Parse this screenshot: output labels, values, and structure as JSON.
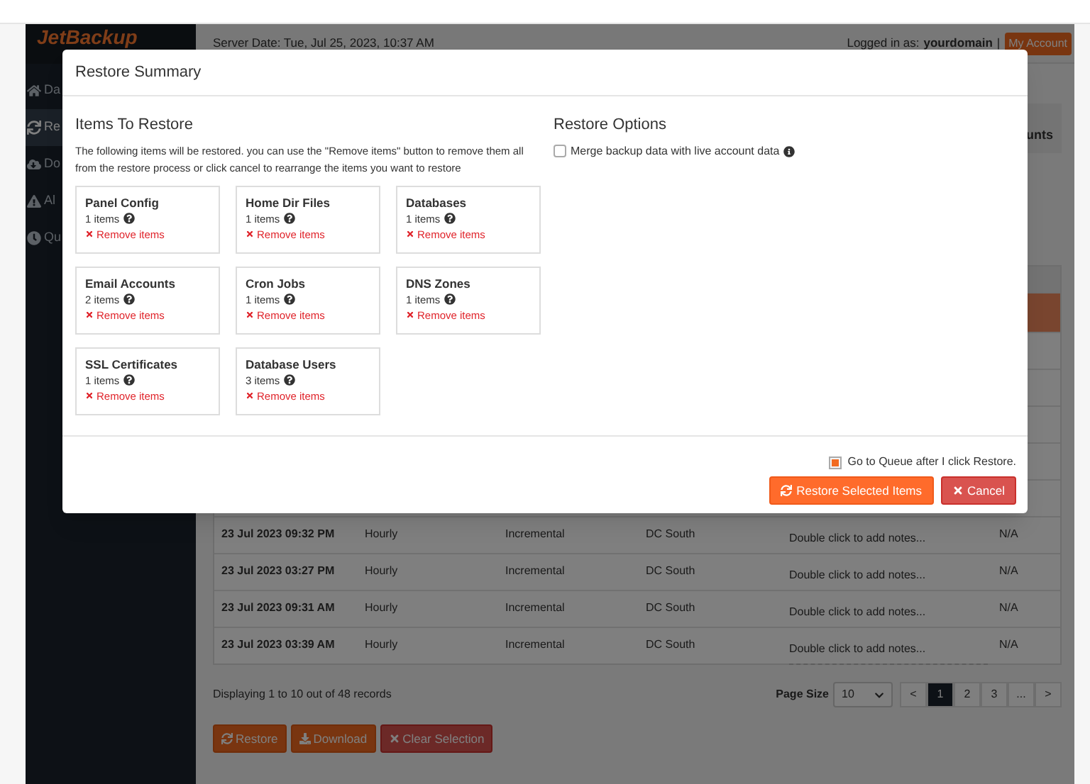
{
  "app": {
    "logo": "JetBackup",
    "server_date": "Server Date: Tue, Jul 25, 2023, 10:37 AM",
    "logged_in_label": "Logged in as:",
    "username": "yourdomain",
    "separator": "|",
    "account_button": "My Account"
  },
  "sidebar": {
    "items": [
      {
        "label": "Da",
        "selected": false
      },
      {
        "label": "Re",
        "selected": true
      },
      {
        "label": "Do",
        "selected": false
      },
      {
        "label": "Al",
        "selected": false
      },
      {
        "label": "Qu",
        "selected": false
      }
    ]
  },
  "background_tab": {
    "label": "unts"
  },
  "table": {
    "rows": [
      {
        "selected": true
      },
      {
        "selected": false
      },
      {
        "selected": false
      },
      {
        "selected": false
      },
      {
        "selected": false
      },
      {
        "selected": false
      },
      {
        "selected": false,
        "cells": [
          "23 Jul 2023 09:32 PM",
          "Hourly",
          "Incremental",
          "DC South",
          "Double click to add notes...",
          "N/A"
        ]
      },
      {
        "selected": false,
        "cells": [
          "23 Jul 2023 03:27 PM",
          "Hourly",
          "Incremental",
          "DC South",
          "Double click to add notes...",
          "N/A"
        ]
      },
      {
        "selected": false,
        "cells": [
          "23 Jul 2023 09:31 AM",
          "Hourly",
          "Incremental",
          "DC South",
          "Double click to add notes...",
          "N/A"
        ]
      },
      {
        "selected": false,
        "cells": [
          "23 Jul 2023 03:39 AM",
          "Hourly",
          "Incremental",
          "DC South",
          "Double click to add notes...",
          "N/A"
        ]
      }
    ]
  },
  "footer": {
    "summary": "Displaying 1 to 10 out of 48 records",
    "page_size_label": "Page Size",
    "page_size": "10",
    "pages": [
      {
        "label": "<",
        "selected": false
      },
      {
        "label": "1",
        "selected": true
      },
      {
        "label": "2",
        "selected": false
      },
      {
        "label": "3",
        "selected": false
      },
      {
        "label": "...",
        "selected": false
      },
      {
        "label": ">",
        "selected": false
      }
    ]
  },
  "actions": [
    {
      "label": "Restore",
      "kind": "primary"
    },
    {
      "label": "Download",
      "kind": "primary"
    },
    {
      "label": "Clear Selection",
      "kind": "danger"
    }
  ],
  "modal": {
    "title": "Restore Summary",
    "items_heading": "Items To Restore",
    "items_description": "The following items will be restored. you can use the \"Remove items\" button to remove them all from the restore process or click cancel to rearrange the items you want to restore",
    "items": [
      {
        "name": "Panel Config",
        "count": "1 items",
        "remove": "Remove items"
      },
      {
        "name": "Home Dir Files",
        "count": "1 items",
        "remove": "Remove items"
      },
      {
        "name": "Databases",
        "count": "1 items",
        "remove": "Remove items"
      },
      {
        "name": "Email Accounts",
        "count": "2 items",
        "remove": "Remove items"
      },
      {
        "name": "Cron Jobs",
        "count": "1 items",
        "remove": "Remove items"
      },
      {
        "name": "DNS Zones",
        "count": "1 items",
        "remove": "Remove items"
      },
      {
        "name": "SSL Certificates",
        "count": "1 items",
        "remove": "Remove items"
      },
      {
        "name": "Database Users",
        "count": "3 items",
        "remove": "Remove items"
      }
    ],
    "options_heading": "Restore Options",
    "options": [
      {
        "label": "Merge backup data with live account data",
        "checked": false
      }
    ],
    "go_to_queue": {
      "label": "Go to Queue after I click Restore.",
      "checked": true
    },
    "buttons": [
      {
        "label": "Restore Selected Items",
        "kind": "primary"
      },
      {
        "label": "Cancel",
        "kind": "danger"
      }
    ]
  }
}
